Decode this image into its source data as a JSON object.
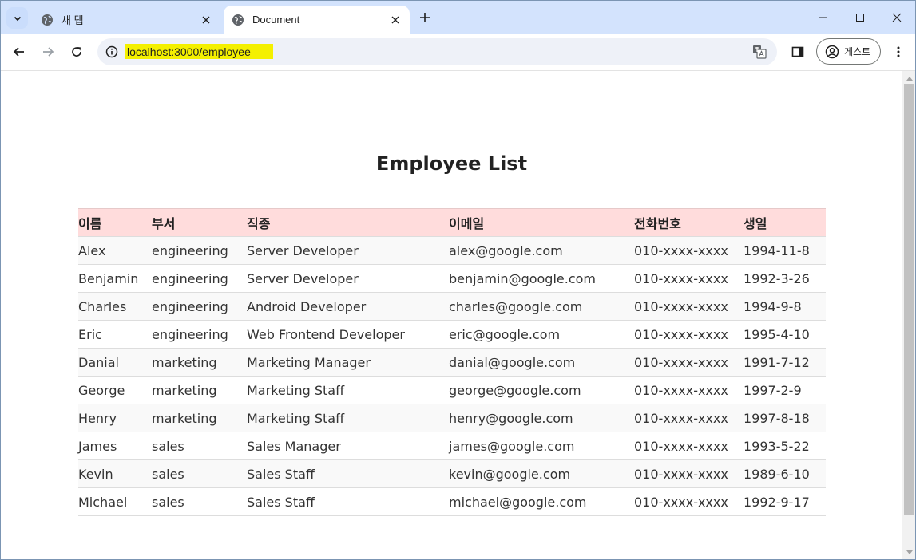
{
  "browser": {
    "tabs": [
      {
        "title": "새 탭",
        "active": false
      },
      {
        "title": "Document",
        "active": true
      }
    ],
    "url": "localhost:3000/employee",
    "profile_label": "게스트"
  },
  "page": {
    "title": "Employee List",
    "columns": [
      "이름",
      "부서",
      "직종",
      "이메일",
      "전화번호",
      "생일"
    ],
    "rows": [
      [
        "Alex",
        "engineering",
        "Server Developer",
        "alex@google.com",
        "010-xxxx-xxxx",
        "1994-11-8"
      ],
      [
        "Benjamin",
        "engineering",
        "Server Developer",
        "benjamin@google.com",
        "010-xxxx-xxxx",
        "1992-3-26"
      ],
      [
        "Charles",
        "engineering",
        "Android Developer",
        "charles@google.com",
        "010-xxxx-xxxx",
        "1994-9-8"
      ],
      [
        "Eric",
        "engineering",
        "Web Frontend Developer",
        "eric@google.com",
        "010-xxxx-xxxx",
        "1995-4-10"
      ],
      [
        "Danial",
        "marketing",
        "Marketing Manager",
        "danial@google.com",
        "010-xxxx-xxxx",
        "1991-7-12"
      ],
      [
        "George",
        "marketing",
        "Marketing Staff",
        "george@google.com",
        "010-xxxx-xxxx",
        "1997-2-9"
      ],
      [
        "Henry",
        "marketing",
        "Marketing Staff",
        "henry@google.com",
        "010-xxxx-xxxx",
        "1997-8-18"
      ],
      [
        "James",
        "sales",
        "Sales Manager",
        "james@google.com",
        "010-xxxx-xxxx",
        "1993-5-22"
      ],
      [
        "Kevin",
        "sales",
        "Sales Staff",
        "kevin@google.com",
        "010-xxxx-xxxx",
        "1989-6-10"
      ],
      [
        "Michael",
        "sales",
        "Sales Staff",
        "michael@google.com",
        "010-xxxx-xxxx",
        "1992-9-17"
      ]
    ]
  },
  "colors": {
    "tabstrip": "#d3e3fd",
    "header_row": "#ffdcdc",
    "url_highlight": "#f4f000"
  }
}
